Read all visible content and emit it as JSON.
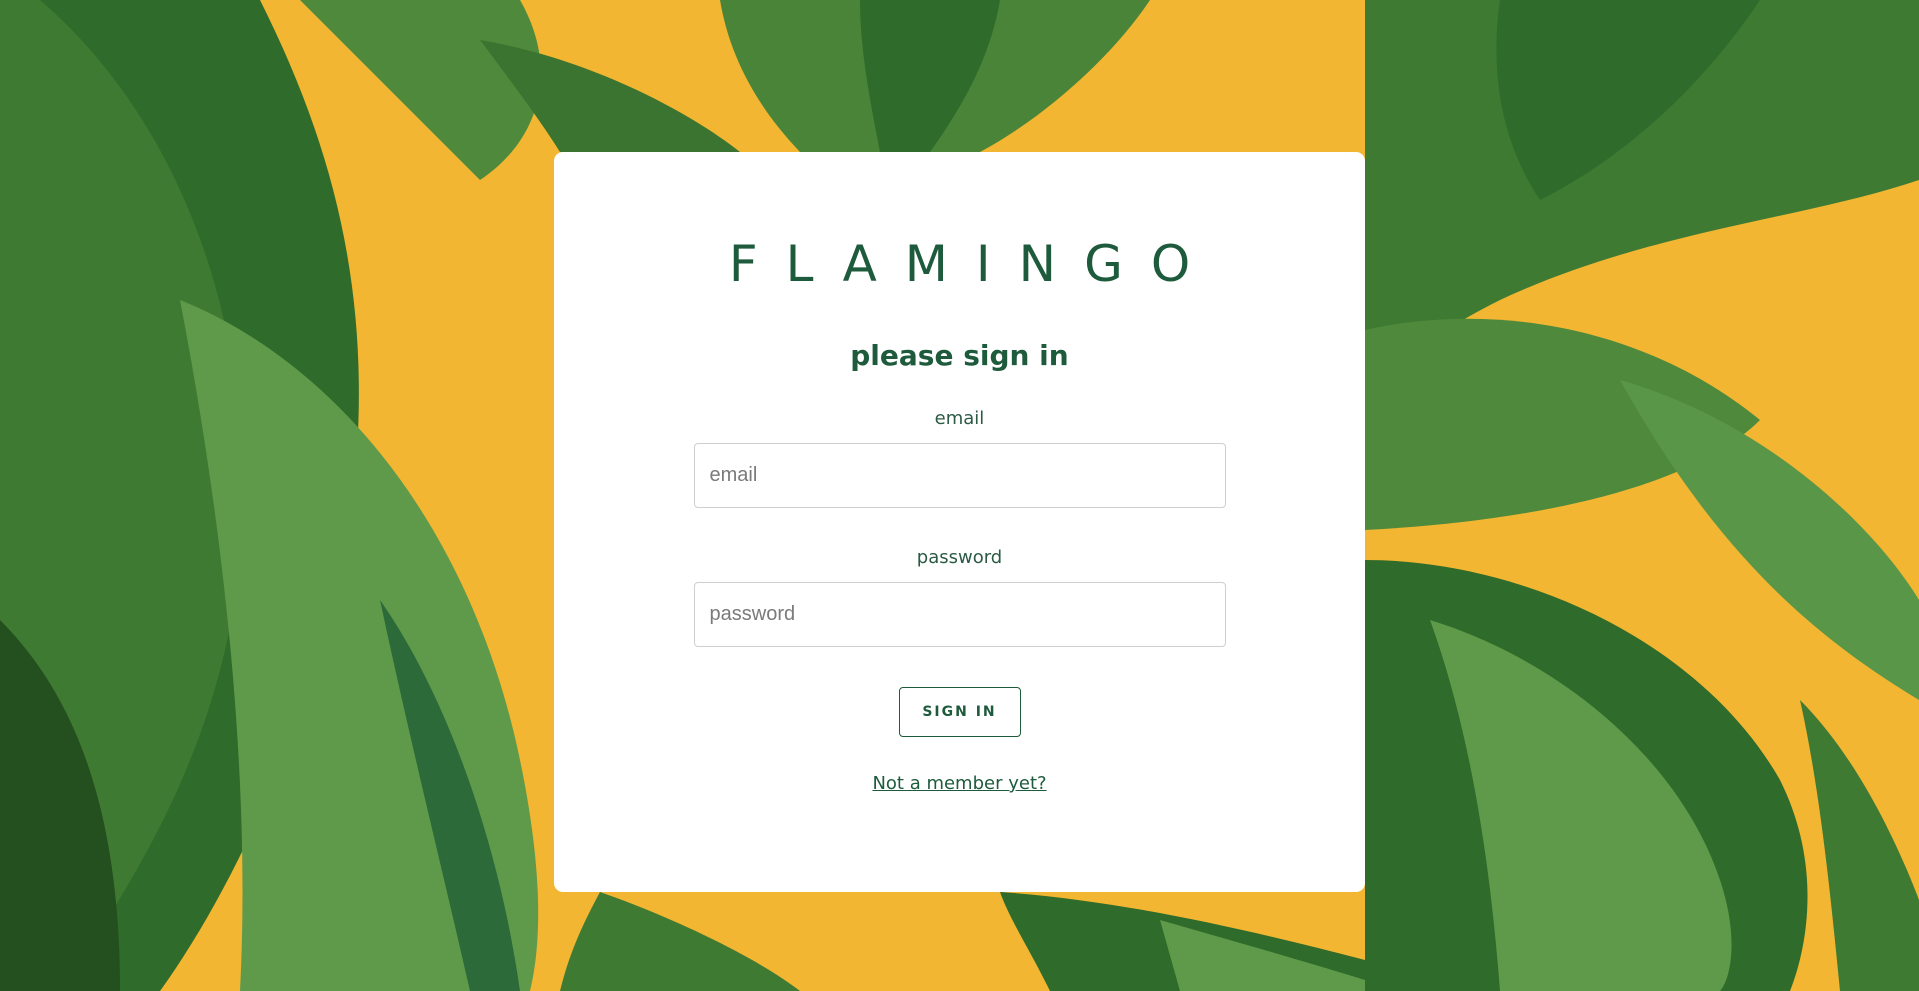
{
  "brand": "FLAMINGO",
  "heading": "please sign in",
  "form": {
    "email_label": "email",
    "email_placeholder": "email",
    "email_value": "",
    "password_label": "password",
    "password_placeholder": "password",
    "password_value": "",
    "signin_label": "SIGN IN",
    "register_link": "Not a member yet?"
  },
  "colors": {
    "background": "#f2b632",
    "leaf_dark": "#2f6b2a",
    "leaf_light": "#5f9a4a",
    "accent": "#1e5b3c"
  }
}
